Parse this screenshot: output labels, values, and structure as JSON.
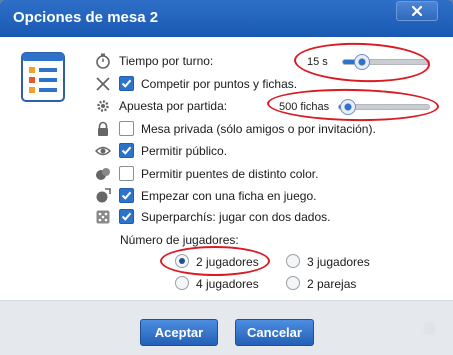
{
  "window": {
    "title": "Opciones de mesa 2"
  },
  "options": {
    "time_per_turn": {
      "label": "Tiempo por turno:",
      "value_text": "15 s",
      "level": 0.18
    },
    "compete_points": {
      "label": "Competir por puntos y fichas.",
      "checked": true
    },
    "bet_per_game": {
      "label": "Apuesta por partida:",
      "value_text": "500 fichas",
      "level": 0.05
    },
    "private_table": {
      "label": "Mesa privada (sólo amigos o por invitación).",
      "checked": false
    },
    "allow_public": {
      "label": "Permitir público.",
      "checked": true
    },
    "allow_bridges": {
      "label": "Permitir puentes de distinto color.",
      "checked": false
    },
    "start_token": {
      "label": "Empezar con una ficha en juego.",
      "checked": true
    },
    "superparchis": {
      "label": "Superparchís: jugar con dos dados.",
      "checked": true
    }
  },
  "players": {
    "label": "Número de jugadores:",
    "choices": [
      "2 jugadores",
      "3 jugadores",
      "4 jugadores",
      "2 parejas"
    ],
    "selected": "2 jugadores"
  },
  "footer": {
    "accept": "Aceptar",
    "cancel": "Cancelar"
  },
  "colors": {
    "accent": "#2e72c9",
    "titlebar": "#1f5fb8",
    "annotation": "#d91c24"
  }
}
